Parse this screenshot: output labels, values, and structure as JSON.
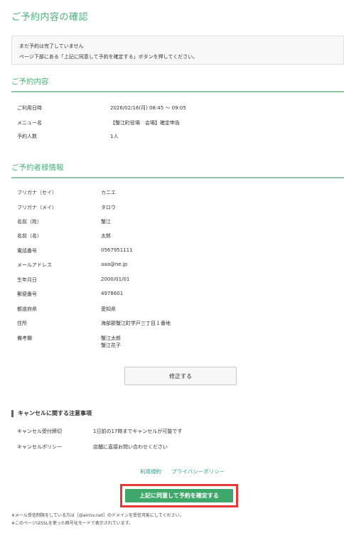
{
  "page_title": "ご予約内容の確認",
  "notice": {
    "line1": "まだ予約は完了していません",
    "line2": "ページ下部にある「上記に同意して予約を確定する」ボタンを押してください。"
  },
  "reservation": {
    "title": "ご予約内容",
    "rows": [
      {
        "label": "ご利用日時",
        "value": "2026/02/16(月) 08:45 ～ 09:05"
      },
      {
        "label": "メニュー名",
        "value": "【蟹江町役場　会場】確定申告"
      },
      {
        "label": "予約人数",
        "value": "1人"
      }
    ]
  },
  "booker": {
    "title": "ご予約者様情報",
    "rows": [
      {
        "label": "フリガナ（セイ）",
        "value": "カニエ"
      },
      {
        "label": "フリガナ（メイ）",
        "value": "タロウ"
      },
      {
        "label": "名前（姓）",
        "value": "蟹江"
      },
      {
        "label": "名前（名）",
        "value": "太郎"
      },
      {
        "label": "電話番号",
        "value": "0567951111"
      },
      {
        "label": "メールアドレス",
        "value": "aaa@ne.jp"
      },
      {
        "label": "生年月日",
        "value": "2000/01/01"
      },
      {
        "label": "郵便番号",
        "value": "4978601"
      },
      {
        "label": "都道府県",
        "value": "愛知県"
      },
      {
        "label": "住所",
        "value": "海部郡蟹江町学戸三丁目１番地"
      },
      {
        "label": "備考欄",
        "value": "蟹江太郎",
        "value2": "蟹江花子"
      }
    ]
  },
  "fix_button": "修正する",
  "cancel": {
    "title": "キャンセルに関する注意事項",
    "rows": [
      {
        "label": "キャンセル受付締切",
        "value": "1日前の17時までキャンセルが可能です"
      },
      {
        "label": "キャンセルポリシー",
        "value": "店舗に直接お問い合わせください"
      }
    ]
  },
  "links": {
    "terms": "利用規約",
    "privacy": "プライバシーポリシー"
  },
  "agree_button": "上記に同意して予約を確定する",
  "footnotes": [
    "※メール受信制限をしている方は［@airrsv.net］のドメインを受信可能にしてください。",
    "※このページはSSLを使った暗号化モードで表示されています。"
  ],
  "colors": {
    "accent": "#4caf7d",
    "confirm": "#3ea86b",
    "highlight": "#e53935"
  }
}
